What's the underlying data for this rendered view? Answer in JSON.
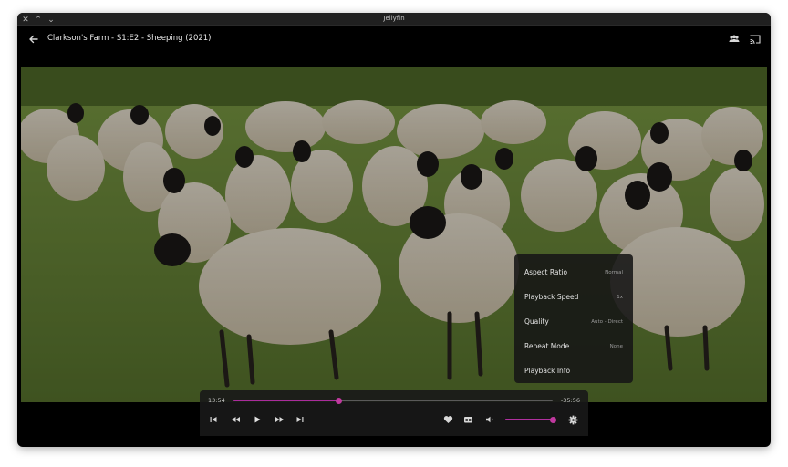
{
  "window": {
    "title": "Jellyfin"
  },
  "header": {
    "title": "Clarkson's Farm - S1:E2 - Sheeping (2021)"
  },
  "player": {
    "current_time": "13:54",
    "remaining_time": "-35:56",
    "progress_fraction": 0.33,
    "volume_fraction": 1.0,
    "accent_color": "#aa2c9c"
  },
  "settings_menu": {
    "items": [
      {
        "label": "Aspect Ratio",
        "value": "Normal"
      },
      {
        "label": "Playback Speed",
        "value": "1x"
      },
      {
        "label": "Quality",
        "value": "Auto - Direct"
      },
      {
        "label": "Repeat Mode",
        "value": "None"
      },
      {
        "label": "Playback Info",
        "value": ""
      }
    ]
  },
  "icons": {
    "window_controls": [
      "close-icon",
      "maximize-icon",
      "minimize-icon"
    ],
    "header": [
      "back-arrow-icon",
      "sync-play-icon",
      "cast-icon"
    ],
    "playback": [
      "previous-track-icon",
      "rewind-icon",
      "play-icon",
      "fast-forward-icon",
      "next-track-icon"
    ],
    "secondary": [
      "favorite-heart-icon",
      "subtitles-icon",
      "volume-icon",
      "settings-gear-icon"
    ]
  }
}
